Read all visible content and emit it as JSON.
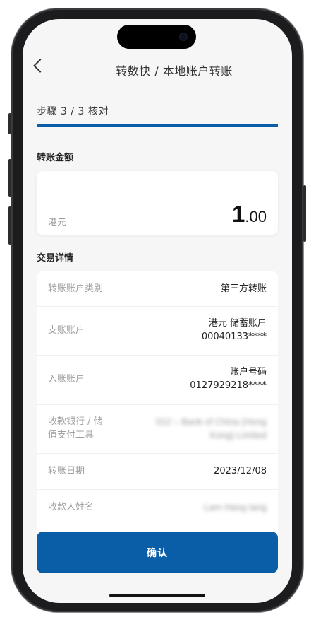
{
  "header": {
    "title": "转数快 / 本地账户转账",
    "back_icon": "chevron-left-icon"
  },
  "step": {
    "label": "步骤 3 / 3  核对",
    "progress": 1.0,
    "progress_color": "#0a5ea8"
  },
  "amount": {
    "section_title": "转账金额",
    "currency": "港元",
    "integer_part": "1",
    "decimal_part": ".00"
  },
  "details": {
    "section_title": "交易详情",
    "rows": [
      {
        "label": "转账账户类别",
        "value_lines": [
          "第三方转账"
        ]
      },
      {
        "label": "支账账户",
        "value_lines": [
          "港元 储蓄账户",
          "00040133****"
        ]
      },
      {
        "label": "入账账户",
        "value_lines": [
          "账户号码",
          "0127929218****"
        ]
      },
      {
        "label_lines": [
          "收款银行 / 储",
          "值支付工具"
        ],
        "value_lines": [
          "012 – Bank of China (Hong",
          "Kong) Limited"
        ]
      },
      {
        "label": "转账日期",
        "value_lines": [
          "2023/12/08"
        ]
      },
      {
        "label": "收款人姓名",
        "value_lines": [
          "Lam Hang Iang"
        ]
      }
    ]
  },
  "actions": {
    "confirm_label": "确认"
  },
  "colors": {
    "accent": "#0a5ea8",
    "screen_background": "#f6f6f7"
  }
}
